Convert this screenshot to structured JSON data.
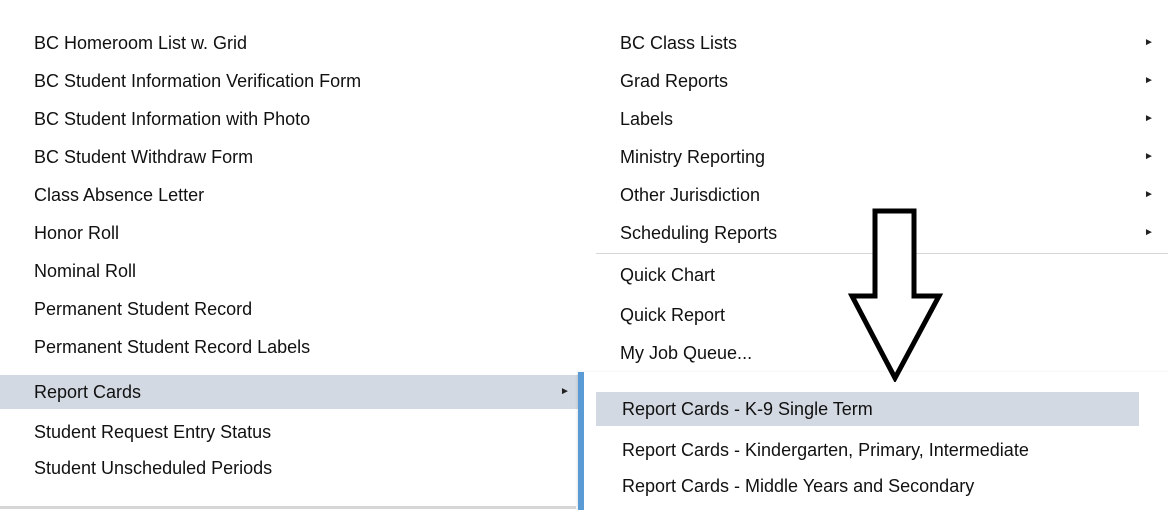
{
  "left_menu": {
    "items": [
      {
        "label": "BC Homeroom List w. Grid"
      },
      {
        "label": "BC Student Information Verification Form"
      },
      {
        "label": "BC Student Information with Photo"
      },
      {
        "label": "BC Student Withdraw Form"
      },
      {
        "label": "Class Absence Letter"
      },
      {
        "label": "Honor Roll"
      },
      {
        "label": "Nominal Roll"
      },
      {
        "label": "Permanent Student Record"
      },
      {
        "label": "Permanent Student Record Labels"
      },
      {
        "label": "Report Cards",
        "submenu_arrow": "►",
        "highlighted": true
      },
      {
        "label": "Student Request Entry Status"
      },
      {
        "label": "Student Unscheduled Periods"
      }
    ]
  },
  "right_menu": {
    "items": [
      {
        "label": "BC Class Lists",
        "submenu_arrow": "►"
      },
      {
        "label": "Grad Reports",
        "submenu_arrow": "►"
      },
      {
        "label": "Labels",
        "submenu_arrow": "►"
      },
      {
        "label": "Ministry Reporting",
        "submenu_arrow": "►"
      },
      {
        "label": "Other Jurisdiction",
        "submenu_arrow": "►"
      },
      {
        "label": "Scheduling Reports",
        "submenu_arrow": "►"
      },
      {
        "label": "Quick Chart"
      },
      {
        "label": "Quick Report"
      },
      {
        "label": "My Job Queue..."
      }
    ]
  },
  "submenu": {
    "items": [
      {
        "label": "Report Cards - K-9 Single Term",
        "highlighted": true
      },
      {
        "label": "Report Cards - Kindergarten, Primary, Intermediate"
      },
      {
        "label": "Report Cards - Middle Years and Secondary"
      }
    ]
  },
  "annotation": {
    "icon": "down-arrow-icon"
  },
  "colors": {
    "highlight": "#d3d9e2",
    "submenu_border": "#5b9bd5",
    "separator": "#d6d6d6",
    "text": "#111111"
  }
}
